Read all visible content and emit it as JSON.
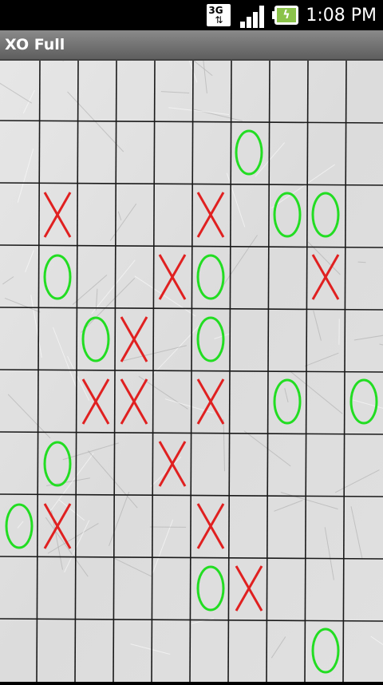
{
  "status_bar": {
    "network_label": "3G",
    "time": "1:08 PM",
    "icons": [
      "3g-icon",
      "signal-icon",
      "battery-charging-icon"
    ]
  },
  "app": {
    "title": "XO Full"
  },
  "board": {
    "columns": 10,
    "rows": 10,
    "x_color": "#e02020",
    "o_color": "#22dd22",
    "paper_color": "#dcdcdc",
    "grid_color": "#1a1a1a",
    "marks": [
      {
        "mark": "O",
        "row": 1,
        "col": 6
      },
      {
        "mark": "X",
        "row": 2,
        "col": 1
      },
      {
        "mark": "X",
        "row": 2,
        "col": 5
      },
      {
        "mark": "O",
        "row": 2,
        "col": 7
      },
      {
        "mark": "O",
        "row": 2,
        "col": 8
      },
      {
        "mark": "O",
        "row": 3,
        "col": 1
      },
      {
        "mark": "X",
        "row": 3,
        "col": 4
      },
      {
        "mark": "O",
        "row": 3,
        "col": 5
      },
      {
        "mark": "X",
        "row": 3,
        "col": 8
      },
      {
        "mark": "O",
        "row": 4,
        "col": 2
      },
      {
        "mark": "X",
        "row": 4,
        "col": 3
      },
      {
        "mark": "O",
        "row": 4,
        "col": 5
      },
      {
        "mark": "X",
        "row": 5,
        "col": 2
      },
      {
        "mark": "X",
        "row": 5,
        "col": 3
      },
      {
        "mark": "X",
        "row": 5,
        "col": 5
      },
      {
        "mark": "O",
        "row": 5,
        "col": 7
      },
      {
        "mark": "O",
        "row": 5,
        "col": 9
      },
      {
        "mark": "O",
        "row": 6,
        "col": 1
      },
      {
        "mark": "X",
        "row": 6,
        "col": 4
      },
      {
        "mark": "O",
        "row": 7,
        "col": 0
      },
      {
        "mark": "X",
        "row": 7,
        "col": 1
      },
      {
        "mark": "X",
        "row": 7,
        "col": 5
      },
      {
        "mark": "O",
        "row": 8,
        "col": 5
      },
      {
        "mark": "X",
        "row": 8,
        "col": 6
      },
      {
        "mark": "O",
        "row": 9,
        "col": 8
      }
    ]
  }
}
